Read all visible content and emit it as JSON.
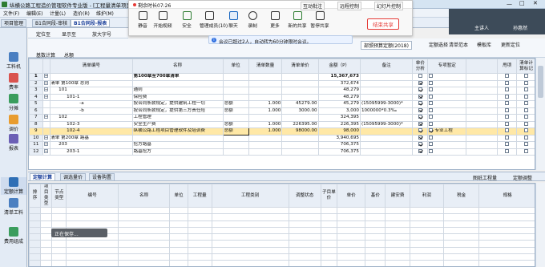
{
  "window": {
    "title": "纵横公路工程造价管理软件专业版 - [工程量清单项目]"
  },
  "menu": {
    "items": [
      "文件(F)",
      "编辑(E)",
      "计量(L)",
      "造价(R)",
      "维护(M)"
    ]
  },
  "project_tabs": {
    "items": [
      "项目管理",
      "B1合同段-审核",
      "B1合同段-报表"
    ]
  },
  "left_sidebar": {
    "items": [
      {
        "label": "工料机",
        "icon": "materials-icon"
      },
      {
        "label": "费率",
        "icon": "rate-icon"
      },
      {
        "label": "分摊",
        "icon": "allocation-icon"
      },
      {
        "label": "调价",
        "icon": "price-adjust-icon"
      },
      {
        "label": "报表",
        "icon": "report-icon"
      },
      {
        "label": "定额计算",
        "icon": "quota-calc-icon"
      },
      {
        "label": "清单工料",
        "icon": "bill-materials-icon"
      },
      {
        "label": "费用组成",
        "icon": "cost-composition-icon"
      }
    ]
  },
  "sub_toolbar": {
    "row1": [
      "定位至",
      "显示至",
      "放大字号"
    ],
    "row2": [
      "基数计算",
      "总额"
    ],
    "right": [
      "定额选择",
      "清单范本",
      "模板库",
      "更新定位"
    ],
    "standard_select": "部颁预算定额(2018)"
  },
  "meeting": {
    "timer": "剩余时长07:26",
    "buttons": [
      {
        "label": "静音",
        "icon": "microphone-icon"
      },
      {
        "label": "开始视频",
        "icon": "video-icon"
      },
      {
        "label": "安全",
        "icon": "shield-icon"
      },
      {
        "label": "管理成员(10)",
        "icon": "members-icon"
      },
      {
        "label": "聊天",
        "icon": "chat-icon"
      },
      {
        "label": "录制",
        "icon": "record-icon"
      },
      {
        "label": "更多",
        "icon": "more-icon"
      },
      {
        "label": "新的共享",
        "icon": "share-icon"
      },
      {
        "label": "暂停共享",
        "icon": "pause-icon"
      }
    ],
    "top_actions": [
      "互动批注",
      "远程控制",
      "幻灯片控制"
    ],
    "end_share": "结束共享",
    "notice": "会议已超过2人，自动转为60分钟限时会议。",
    "participant_label": "主讲人",
    "participant_name": "孙惠然"
  },
  "main_table": {
    "headers": [
      "",
      "",
      "清单编号",
      "名称",
      "单位",
      "清单数量",
      "清单单价",
      "金额（P）",
      "备注",
      "单价分析",
      "专项暂定",
      "",
      "甩项",
      "清单计算标记"
    ],
    "rows": [
      {
        "n": "1",
        "code": "",
        "name": "第100章至700章清单",
        "unit": "",
        "qty": "",
        "price": "",
        "amount": "15,367,673",
        "note": "",
        "bold": true,
        "ana": false,
        "spec": false
      },
      {
        "n": "2",
        "code": "清单 第100章  总则",
        "name": "",
        "unit": "",
        "qty": "",
        "price": "",
        "amount": "372,674",
        "note": "",
        "bold": false,
        "ana": true,
        "spec": false
      },
      {
        "n": "3",
        "code": "101",
        "name": "通则",
        "unit": "",
        "qty": "",
        "price": "",
        "amount": "48,279",
        "note": "",
        "ana": true,
        "spec": false
      },
      {
        "n": "4",
        "code": "101-1",
        "name": "保险费",
        "unit": "",
        "qty": "",
        "price": "",
        "amount": "48,279",
        "note": "",
        "ana": true,
        "spec": false
      },
      {
        "n": "5",
        "code": "-a",
        "name": "按合同条款规定，提供建筑工程一切",
        "unit": "总额",
        "qty": "1.000",
        "price": "45279.00",
        "amount": "45,279",
        "note": "(15095999-3000)*",
        "ana": true,
        "spec": false
      },
      {
        "n": "6",
        "code": "-b",
        "name": "按合同条款规定，提供第三方责任险",
        "unit": "总额",
        "qty": "1.000",
        "price": "3000.00",
        "amount": "3,000",
        "note": "1000000*0.3‰",
        "ana": true,
        "spec": false
      },
      {
        "n": "7",
        "code": "102",
        "name": "工程管理",
        "unit": "",
        "qty": "",
        "price": "",
        "amount": "324,395",
        "note": "",
        "ana": true,
        "spec": false
      },
      {
        "n": "8",
        "code": "102-3",
        "name": "安全生产费",
        "unit": "总额",
        "qty": "1.000",
        "price": "226395.00",
        "amount": "226,395",
        "note": "(15095999-3000)*",
        "ana": true,
        "spec": false
      },
      {
        "n": "9",
        "code": "102-4",
        "name": "纵横公路工程项目管理软件及培训费",
        "unit": "总额",
        "qty": "1.000",
        "price": "98000.00",
        "amount": "98,000",
        "note": "",
        "ana": true,
        "spec": true,
        "extra": "专业工程",
        "hl": true
      },
      {
        "n": "10",
        "code": "清单 第200章  路基",
        "name": "",
        "unit": "",
        "qty": "",
        "price": "",
        "amount": "3,940,695",
        "note": "",
        "ana": true,
        "spec": false
      },
      {
        "n": "11",
        "code": "203",
        "name": "挖方路基",
        "unit": "",
        "qty": "",
        "price": "",
        "amount": "706,375",
        "note": "",
        "ana": true,
        "spec": false
      },
      {
        "n": "12",
        "code": "203-1",
        "name": "路基挖方",
        "unit": "",
        "qty": "",
        "price": "",
        "amount": "706,375",
        "note": "",
        "ana": true,
        "spec": false
      }
    ]
  },
  "bottom_tabs": {
    "items": [
      "定额计算",
      "调选量价",
      "设备购置"
    ],
    "right": [
      "图纸工程量",
      "定额调整"
    ]
  },
  "bottom_table": {
    "headers": [
      "排序",
      "项目类型",
      "节点类型",
      "编号",
      "名称",
      "单位",
      "工程量",
      "工程类别",
      "调整状态",
      "子目单价",
      "单价",
      "基价",
      "建安费",
      "利润",
      "税金",
      "规格"
    ]
  },
  "popup": {
    "text": "正在保存..."
  }
}
